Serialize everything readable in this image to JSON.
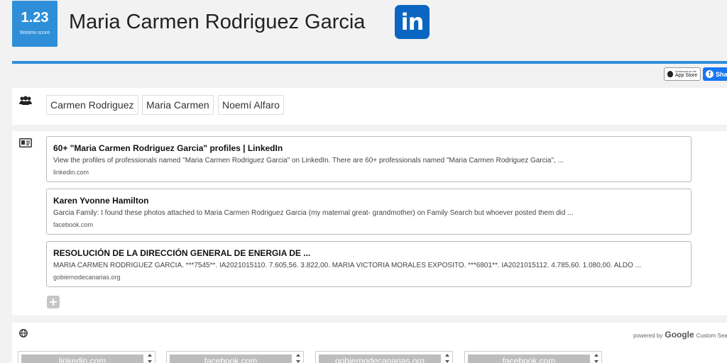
{
  "header": {
    "score_value": "1.23",
    "score_label": "Webmii score",
    "name": "Maria Carmen Rodriguez Garcia",
    "linkedin_logo_text": "in"
  },
  "toolbar": {
    "appstore_small": "Download on the",
    "appstore_big": "App Store",
    "share_label": "Sha"
  },
  "names": {
    "icon": "users-icon",
    "chips": [
      "Carmen Rodriguez",
      "Maria Carmen",
      "Noemí Alfaro"
    ]
  },
  "results": {
    "icon": "id-card-icon",
    "items": [
      {
        "title": "60+ \"Maria Carmen Rodriguez Garcia\" profiles | LinkedIn",
        "snippet": "View the profiles of professionals named \"Maria Carmen Rodriguez Garcia\" on LinkedIn. There are 60+ professionals named \"Maria Carmen Rodriguez Garcia\", ...",
        "domain": "linkedin.com"
      },
      {
        "title": "Karen Yvonne Hamilton",
        "snippet": "Garcia Family: I found these photos attached to Maria Carmen Rodriguez Garcia (my maternal great- grandmother) on Family Search but whoever posted them did ...",
        "domain": "facebook.com"
      },
      {
        "title": "RESOLUCIÓN DE LA DIRECCIÓN GENERAL DE ENERGIA DE ...",
        "snippet": "MARIA CARMEN RODRIGUEZ GARCIA. ***7545**. IA2021015110. 7.605,56. 3.822,00. MARIA VICTORIA MORALES EXPOSITO. ***6801**. IA2021015112. 4.785,60. 1.080,00. ALDO ...",
        "domain": "gobiernodecanarias.org"
      }
    ]
  },
  "web": {
    "icon": "globe-icon",
    "powered_by": "powered by",
    "google": "Google",
    "custom_search": "Custom Sea",
    "sources": [
      "linkedin.com",
      "facebook.com",
      "gobiernodecanarias.org",
      "facebook.com"
    ]
  }
}
